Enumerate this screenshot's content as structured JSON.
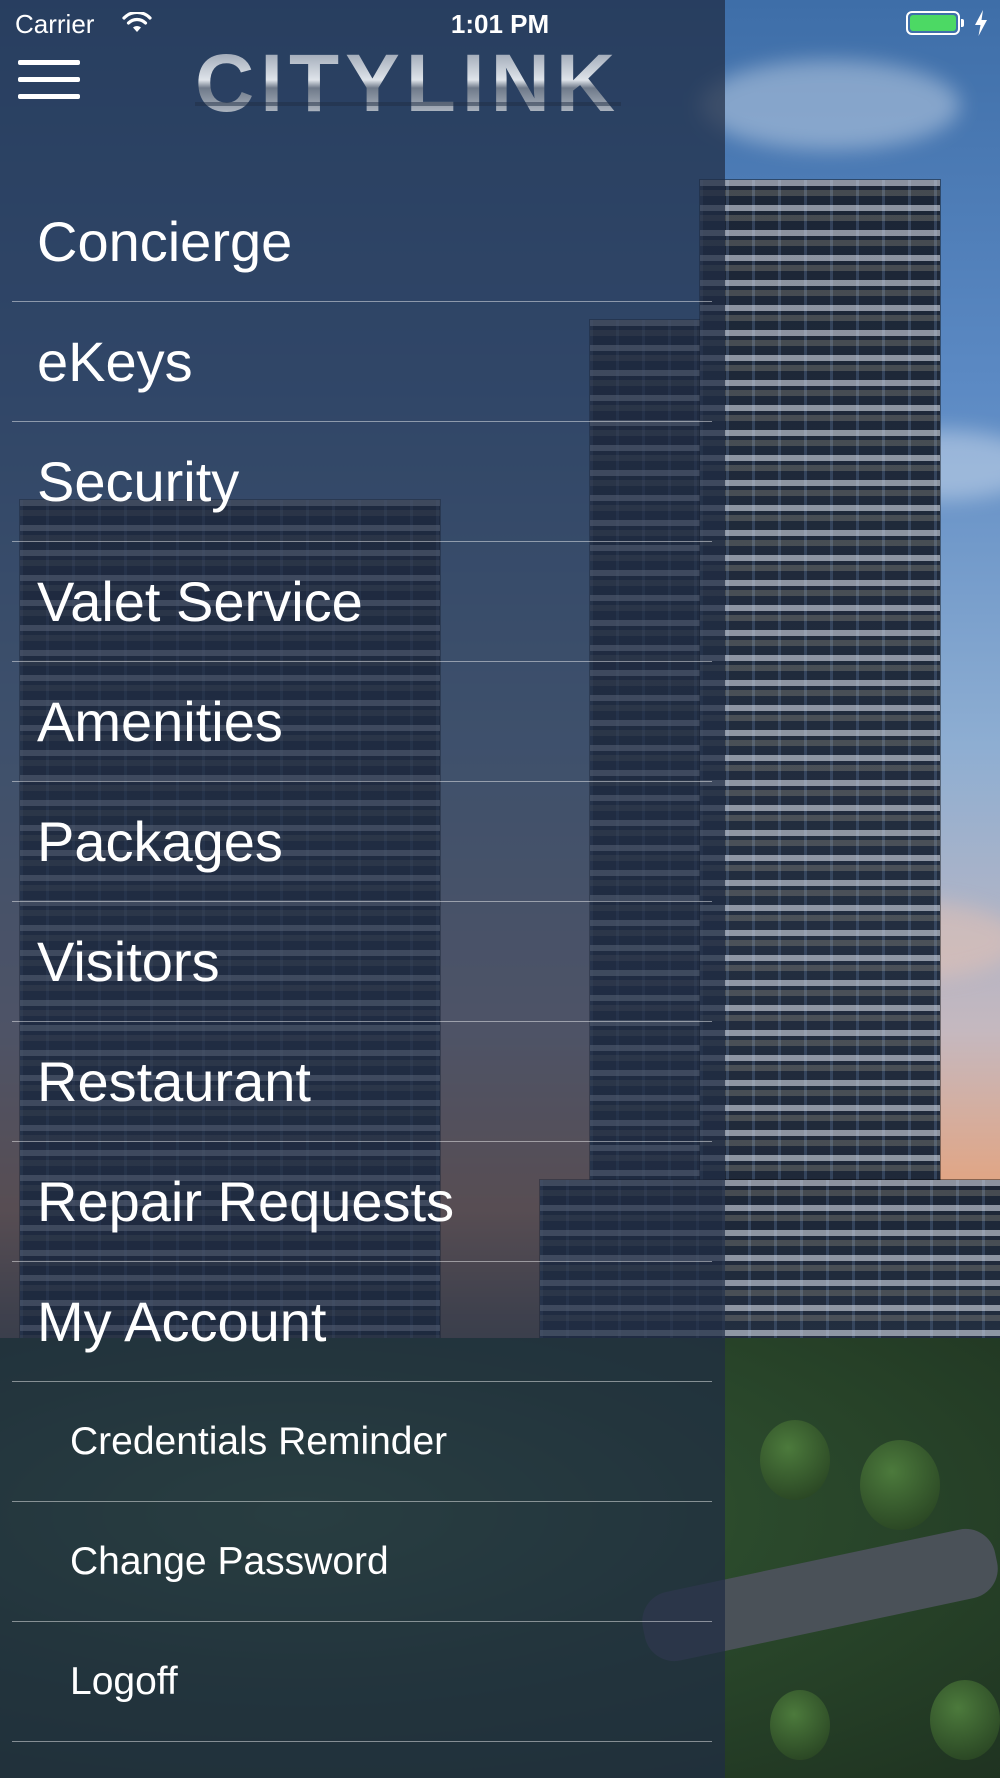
{
  "status_bar": {
    "carrier": "Carrier",
    "time": "1:01 PM",
    "battery_color": "#4cd964",
    "icons": [
      "wifi-icon",
      "battery-icon",
      "charging-bolt-icon"
    ]
  },
  "header": {
    "menu_icon": "hamburger-menu-icon",
    "logo_text": "CITYLINK"
  },
  "drawer": {
    "overlay_color": "#202d44",
    "items": [
      {
        "label": "Concierge"
      },
      {
        "label": "eKeys"
      },
      {
        "label": "Security"
      },
      {
        "label": "Valet Service"
      },
      {
        "label": "Amenities"
      },
      {
        "label": "Packages"
      },
      {
        "label": "Visitors"
      },
      {
        "label": "Restaurant"
      },
      {
        "label": "Repair Requests"
      },
      {
        "label": "My Account"
      }
    ],
    "sub_items": [
      {
        "label": "Credentials Reminder"
      },
      {
        "label": "Change Password"
      },
      {
        "label": "Logoff"
      }
    ]
  }
}
